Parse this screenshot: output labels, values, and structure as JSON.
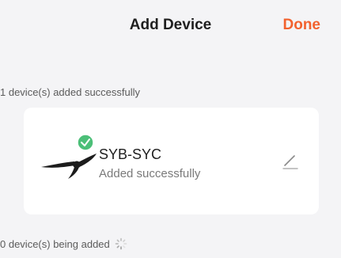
{
  "nav": {
    "title": "Add Device",
    "done_label": "Done"
  },
  "added_summary": "1 device(s) added successfully",
  "device": {
    "name": "SYB-SYC",
    "status": "Added successfully",
    "icon": "ceiling-fan-icon",
    "badge_icon": "checkmark-badge-icon"
  },
  "pending_summary": "0 device(s) being added",
  "colors": {
    "accent": "#f2622e",
    "success": "#4cbf78",
    "background": "#f4f4f6",
    "card": "#ffffff"
  }
}
